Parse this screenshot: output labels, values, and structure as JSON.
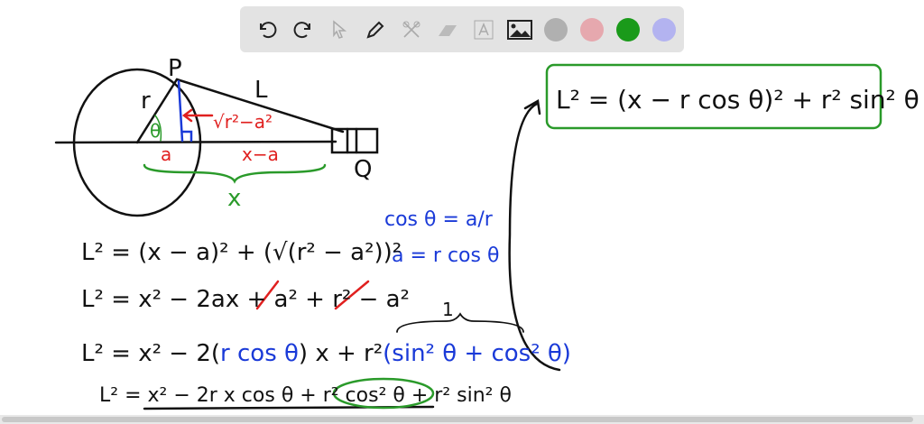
{
  "toolbar": {
    "tools": [
      "undo",
      "redo",
      "select",
      "pen",
      "tools",
      "eraser",
      "text",
      "image"
    ],
    "colors": [
      "#b0b0b0",
      "#e6a8ae",
      "#1a9a1a",
      "#b3b3f0"
    ]
  },
  "diagram": {
    "P": "P",
    "r": "r",
    "L": "L",
    "theta": "θ",
    "sqrt": "√r²−a²",
    "a": "a",
    "xa": "x−a",
    "x": "x",
    "Q": "Q"
  },
  "equations": {
    "boxed": "L² = (x −  r cos θ)² + r² sin² θ",
    "boxed_r": "r",
    "cos": "cos θ = a/r",
    "a_eq": "a = r cos θ",
    "eq1": "L² = (x − a)² + (√(r² − a²))²",
    "eq2": "L² = x² − 2ax + a² + r² − a²",
    "eq3a": "L² = x² − 2(",
    "eq3b": "r cos θ",
    "eq3c": ") x + r²",
    "eq3d": "(sin² θ + cos² θ)",
    "brace_one": "1",
    "eq4a": "L² = x² − 2r x cos θ + ",
    "eq4b": "r² cos² θ",
    "eq4c": " + r² sin² θ"
  }
}
